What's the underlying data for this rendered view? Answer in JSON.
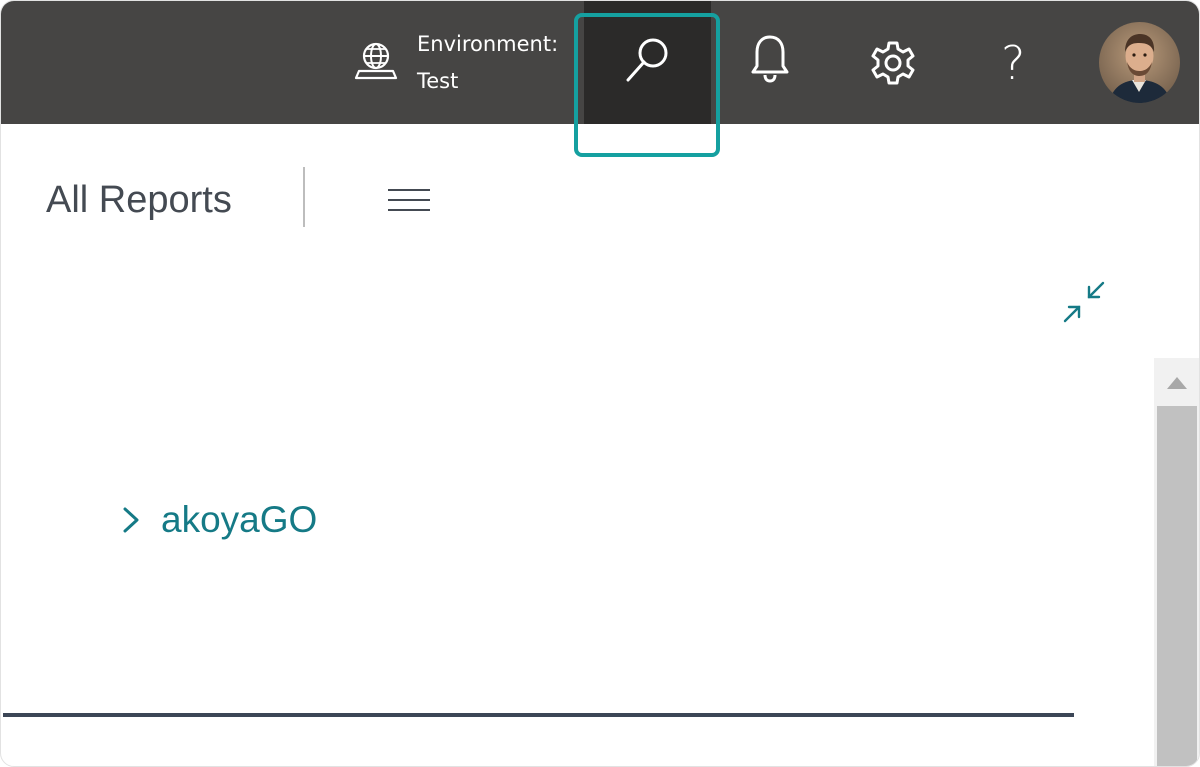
{
  "header": {
    "environment_label": "Environment:",
    "environment_value": "Test",
    "icons": {
      "environment": "globe-laptop-icon",
      "search": "search-icon",
      "notifications": "bell-icon",
      "settings": "gear-icon",
      "help": "question-mark-icon",
      "avatar": "user-avatar"
    },
    "help_glyph": "?"
  },
  "page": {
    "title": "All Reports",
    "menu_icon": "hamburger-menu-icon",
    "collapse_icon": "collapse-arrows-icon"
  },
  "tree": {
    "items": [
      {
        "label": "akoyaGO",
        "expanded": false,
        "icon": "chevron-right-icon"
      }
    ]
  },
  "colors": {
    "topbar": "#464544",
    "search_active": "#2b2a29",
    "highlight": "#15a0a0",
    "accent": "#157a86",
    "title": "#444a52"
  }
}
